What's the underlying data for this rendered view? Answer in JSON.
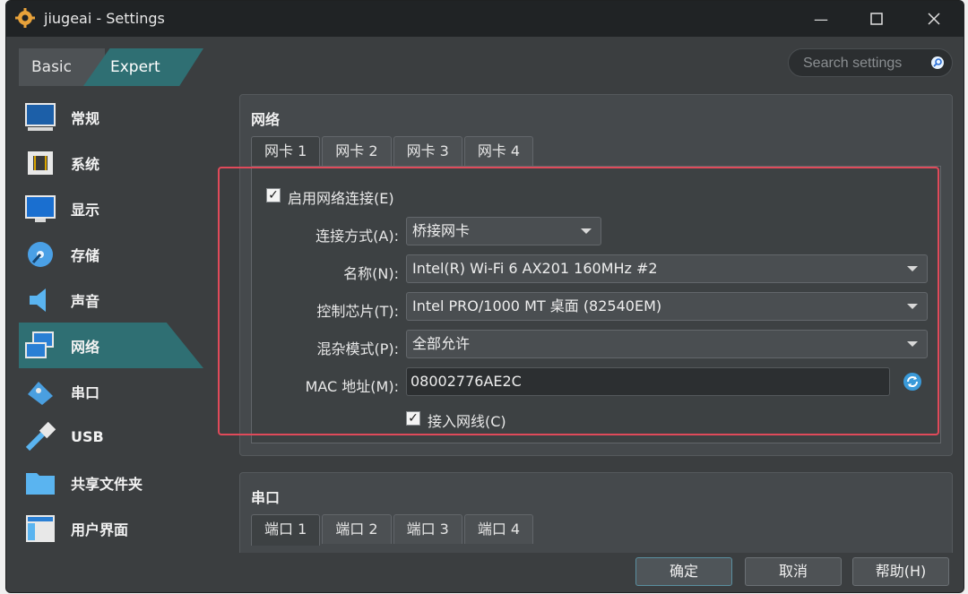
{
  "window": {
    "title": "jiugeai - Settings"
  },
  "mode_tabs": {
    "basic": "Basic",
    "expert": "Expert"
  },
  "search": {
    "placeholder": "Search settings"
  },
  "sidebar": {
    "items": [
      {
        "label": "常规",
        "icon": "general-monitor-icon"
      },
      {
        "label": "系统",
        "icon": "system-chip-icon"
      },
      {
        "label": "显示",
        "icon": "display-monitor-icon"
      },
      {
        "label": "存储",
        "icon": "storage-disk-icon"
      },
      {
        "label": "声音",
        "icon": "audio-speaker-icon"
      },
      {
        "label": "网络",
        "icon": "network-icon"
      },
      {
        "label": "串口",
        "icon": "serial-port-icon"
      },
      {
        "label": "USB",
        "icon": "usb-icon"
      },
      {
        "label": "共享文件夹",
        "icon": "shared-folder-icon"
      },
      {
        "label": "用户界面",
        "icon": "user-interface-icon"
      }
    ],
    "active": "网络"
  },
  "network": {
    "title": "网络",
    "tabs": [
      "网卡 1",
      "网卡 2",
      "网卡 3",
      "网卡 4"
    ],
    "enable_label": "启用网络连接(E)",
    "enabled": true,
    "attached_label": "连接方式(A):",
    "attached_value": "桥接网卡",
    "name_label": "名称(N):",
    "name_value": "Intel(R) Wi-Fi 6 AX201 160MHz #2",
    "adapter_label": "控制芯片(T):",
    "adapter_value": "Intel PRO/1000 MT 桌面 (82540EM)",
    "promisc_label": "混杂模式(P):",
    "promisc_value": "全部允许",
    "mac_label": "MAC 地址(M):",
    "mac_value": "08002776AE2C",
    "cable_label": "接入网线(C)",
    "cable_connected": true
  },
  "serial": {
    "title": "串口",
    "tabs": [
      "端口 1",
      "端口 2",
      "端口 3",
      "端口 4"
    ]
  },
  "footer": {
    "ok": "确定",
    "cancel": "取消",
    "help": "帮助(H)"
  },
  "colors": {
    "accent": "#2f6f73",
    "highlight_border": "#e04a5a",
    "window_bg": "#3b3e40"
  }
}
